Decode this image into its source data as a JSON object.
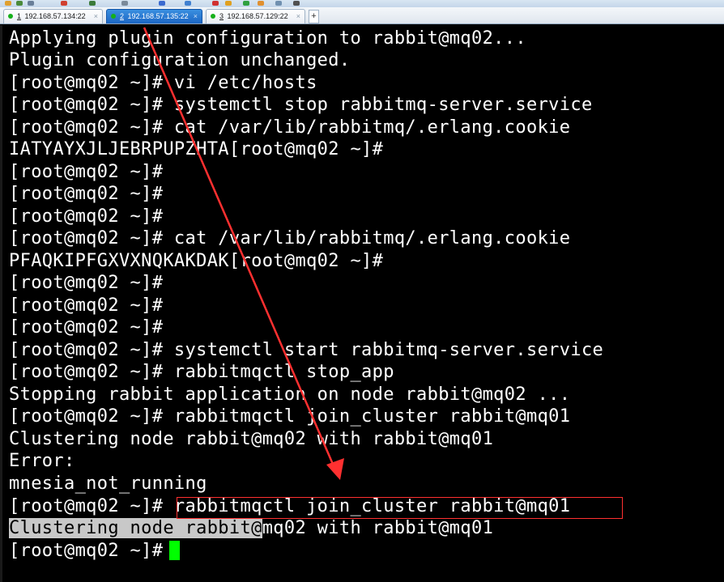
{
  "tabs": [
    {
      "number": "1",
      "label": "192.168.57.134:22",
      "active": false
    },
    {
      "number": "2",
      "label": "192.168.57.135:22",
      "active": true
    },
    {
      "number": "3",
      "label": "192.168.57.129:22",
      "active": false
    }
  ],
  "new_tab_label": "+",
  "colors": {
    "terminal_bg": "#000000",
    "terminal_fg": "#ffffff",
    "cursor": "#00ff00",
    "annotation": "#ff3030",
    "active_tab": "#1c66c4",
    "connected_dot": "#15b01a"
  },
  "terminal": {
    "lines": [
      "Applying plugin configuration to rabbit@mq02...",
      "Plugin configuration unchanged.",
      "[root@mq02 ~]# vi /etc/hosts",
      "[root@mq02 ~]# systemctl stop rabbitmq-server.service",
      "[root@mq02 ~]# cat /var/lib/rabbitmq/.erlang.cookie",
      "IATYAYXJLJEBRPUPZHTA[root@mq02 ~]#",
      "[root@mq02 ~]#",
      "[root@mq02 ~]#",
      "[root@mq02 ~]#",
      "[root@mq02 ~]# cat /var/lib/rabbitmq/.erlang.cookie",
      "PFAQKIPFGXVXNQKAKDAK[root@mq02 ~]#",
      "[root@mq02 ~]#",
      "[root@mq02 ~]#",
      "[root@mq02 ~]#",
      "[root@mq02 ~]# systemctl start rabbitmq-server.service",
      "[root@mq02 ~]# rabbitmqctl stop_app",
      "Stopping rabbit application on node rabbit@mq02 ...",
      "[root@mq02 ~]# rabbitmqctl join_cluster rabbit@mq01",
      "Clustering node rabbit@mq02 with rabbit@mq01",
      "Error:",
      "mnesia_not_running",
      "[root@mq02 ~]# rabbitmqctl join_cluster rabbit@mq01"
    ],
    "selection_text": "Clustering node rabbit@",
    "selection_rest": "mq02 with rabbit@mq01",
    "final_prompt": "[root@mq02 ~]#"
  }
}
